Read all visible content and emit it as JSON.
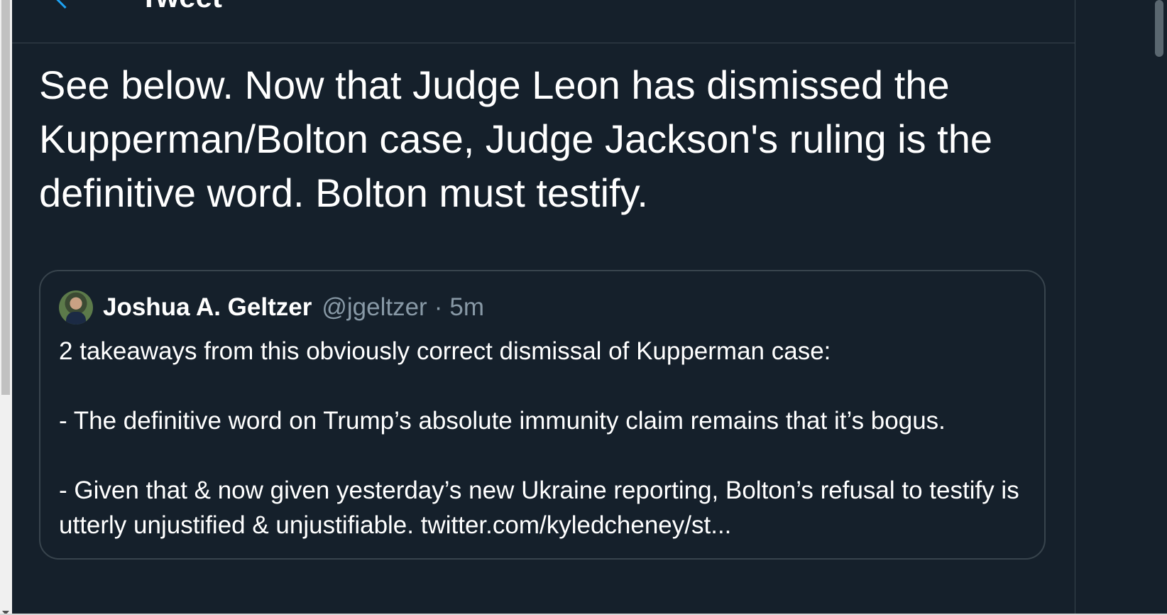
{
  "header": {
    "title": "Tweet"
  },
  "tweet": {
    "text": "See below. Now that Judge Leon has dismissed the Kupperman/Bolton case, Judge Jackson's ruling is the definitive word. Bolton must testify."
  },
  "quote": {
    "author_name": "Joshua A. Geltzer",
    "author_handle": "@jgeltzer",
    "separator": "·",
    "time": "5m",
    "paragraphs": [
      "2 takeaways from this obviously correct dismissal of Kupperman case:",
      "- The definitive word on Trump’s absolute immunity claim remains that it’s bogus.",
      "- Given that & now given yesterday’s new Ukraine reporting, Bolton’s refusal to testify is utterly unjustified & unjustifiable. twitter.com/kyledcheney/st..."
    ]
  },
  "colors": {
    "background": "#15202b",
    "border": "#38444d",
    "text": "#ffffff",
    "secondary_text": "#8899a6",
    "accent": "#1da1f2"
  }
}
